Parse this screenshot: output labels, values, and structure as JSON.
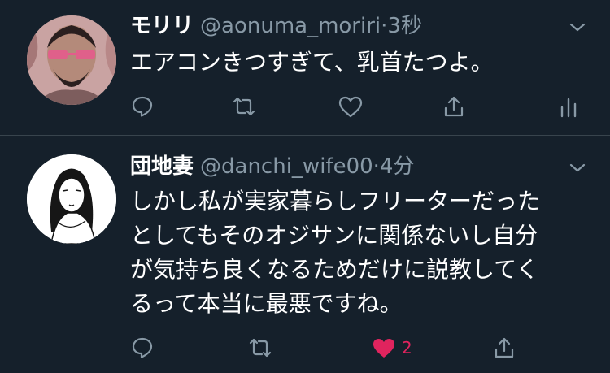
{
  "tweets": [
    {
      "name": "モリリ",
      "handle": "@aonuma_moriri",
      "dot": "·",
      "time": "3秒",
      "text": "エアコンきつすぎて、乳首たつよ。",
      "actions": {
        "reply": "reply-icon",
        "retweet": "retweet-icon",
        "like": "heart-outline-icon",
        "share": "share-icon",
        "analytics": "analytics-icon"
      }
    },
    {
      "name": "団地妻",
      "handle": "@danchi_wife00",
      "dot": "·",
      "time": "4分",
      "text": "しかし私が実家暮らしフリーターだった\nとしてもそのオジサンに関係ないし自分\nが気持ち良くなるためだけに説教してく\nるって本当に最悪ですね。",
      "like_count": "2",
      "actions": {
        "reply": "reply-icon",
        "retweet": "retweet-icon",
        "like": "heart-filled-icon",
        "share": "share-icon"
      }
    }
  ],
  "colors": {
    "background": "#15202b",
    "secondary_text": "#8899a6",
    "divider": "#38444d",
    "like": "#e0245e"
  }
}
